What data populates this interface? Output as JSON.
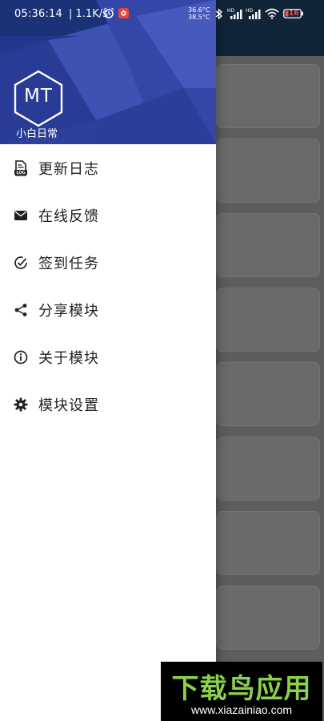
{
  "status": {
    "time": "05:36:14",
    "speed": "1.1K/s",
    "temp_top": "36.6°C",
    "temp_bottom": "38.5°C",
    "battery": "16"
  },
  "header": {
    "logo_text": "MT",
    "app_name": "小白日常",
    "color": "#2e3f9a"
  },
  "menu": {
    "items": [
      {
        "label": "更新日志",
        "icon": "log-file-icon"
      },
      {
        "label": "在线反馈",
        "icon": "mail-icon"
      },
      {
        "label": "签到任务",
        "icon": "check-circle-icon"
      },
      {
        "label": "分享模块",
        "icon": "share-icon"
      },
      {
        "label": "关于模块",
        "icon": "info-icon"
      },
      {
        "label": "模块设置",
        "icon": "gear-icon"
      }
    ]
  },
  "watermark": {
    "title": "下载鸟应用",
    "url": "www.xiazainiao.com"
  }
}
